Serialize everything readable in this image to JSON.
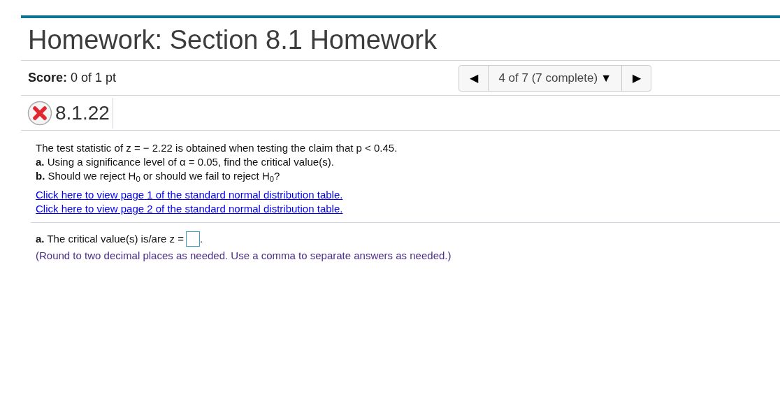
{
  "header": {
    "title": "Homework: Section 8.1 Homework"
  },
  "score": {
    "label": "Score:",
    "value": "0 of 1 pt"
  },
  "navigator": {
    "prev": "◀",
    "position": "4 of 7 (7 complete)",
    "dropdown": "▼",
    "next": "▶"
  },
  "question": {
    "number": "8.1.22",
    "correct": false
  },
  "prompt": [
    "The test statistic of z = − 2.22 is obtained when testing the claim that p < 0.45.",
    "**a.** Using a significance level of α = 0.05, find the critical value(s).",
    "**b.** Should we reject H$_{0}$ or should we fail to reject H$_{0}$?"
  ],
  "links": [
    "Click here to view page 1 of the standard normal distribution table.",
    "Click here to view page 2 of the standard normal distribution table."
  ],
  "answer": {
    "label": "**a.** The critical value(s) is/are z =",
    "suffix": ".",
    "note": "(Round to two decimal places as needed. Use a comma to separate answers as needed.)"
  }
}
